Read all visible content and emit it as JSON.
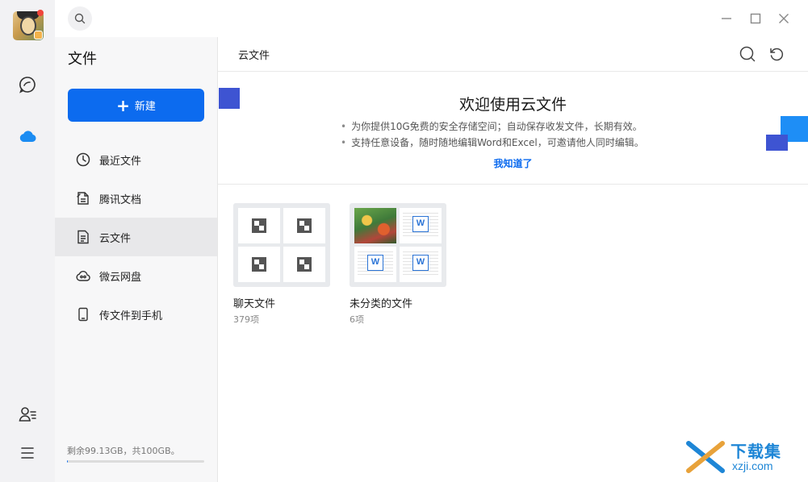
{
  "rail": {
    "icons": [
      "avatar",
      "chat-icon",
      "cloud-icon",
      "contacts-icon",
      "menu-icon"
    ],
    "accent": "#0c6bef"
  },
  "sidebar": {
    "title": "文件",
    "new_button_label": "新建",
    "items": [
      {
        "label": "最近文件",
        "icon": "clock-icon"
      },
      {
        "label": "腾讯文档",
        "icon": "tencent-docs-icon"
      },
      {
        "label": "云文件",
        "icon": "cloud-file-icon"
      },
      {
        "label": "微云网盘",
        "icon": "weiyun-icon"
      },
      {
        "label": "传文件到手机",
        "icon": "phone-icon"
      }
    ],
    "active_index": 2,
    "storage_text": "剩余99.13GB，共100GB。",
    "storage_used_fraction": 0.0087
  },
  "main": {
    "title": "云文件",
    "banner": {
      "title": "欢迎使用云文件",
      "lines": [
        "为你提供10G免费的安全存储空间；自动保存收发文件，长期有效。",
        "支持任意设备，随时随地编辑Word和Excel，可邀请他人同时编辑。"
      ],
      "link": "我知道了"
    },
    "folders": [
      {
        "name": "聊天文件",
        "count": "379项"
      },
      {
        "name": "未分类的文件",
        "count": "6项"
      }
    ]
  },
  "watermark": {
    "title": "下载集",
    "subtitle": "xzji.com"
  }
}
